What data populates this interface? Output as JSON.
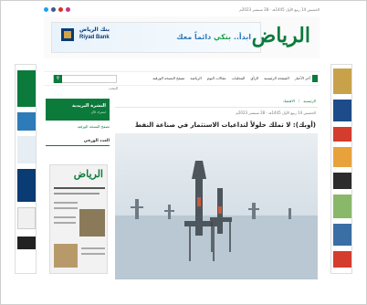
{
  "topbar": {
    "date": "الخميس 14 ربيع الأول 1445هـ - 28 سبتمبر 2023م",
    "social": [
      "twitter-icon",
      "facebook-icon",
      "youtube-icon",
      "instagram-icon"
    ]
  },
  "header": {
    "logo": "الرياض",
    "banner": {
      "bank_ar": "بنك الرياض",
      "bank_en": "Riyad Bank",
      "slogan_prefix": "ابدأ..",
      "slogan_highlight": "بنكي",
      "slogan_suffix": "دائماً معك"
    }
  },
  "nav": {
    "items": [
      "آخر الأخبار",
      "الصفحة الرئيسية",
      "الرأي",
      "المحليات",
      "مقالات اليوم",
      "الرياضة",
      "تصفح النسخة الورقية"
    ],
    "search_placeholder": "البحث"
  },
  "breadcrumb": [
    "الرئيسية",
    "الاقتصاد"
  ],
  "article": {
    "meta": "الخميس 14 ربيع الأول 1445هـ - 28 سبتمبر 2023م",
    "title": "(أوبك): لا تملك حلولاً لتداعيات الاستثمار في صناعة النفط"
  },
  "sidebar": {
    "promo_title": "النشرة البريدية",
    "promo_sub": "اشترك الآن",
    "link": "تصفح النسخة الورقية",
    "head": "العدد الورقي",
    "paper_mast": "الرياض"
  },
  "colors": {
    "brand_green": "#0b7a3b",
    "bank_blue": "#0a3b73"
  }
}
